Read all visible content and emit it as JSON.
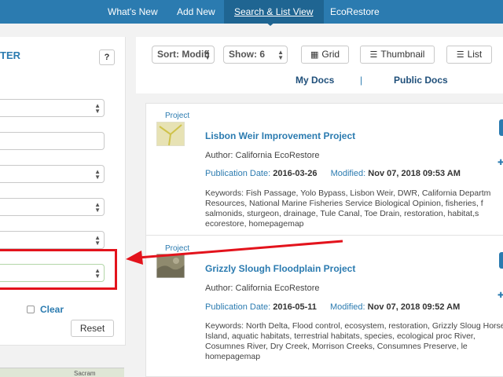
{
  "nav": {
    "items": [
      {
        "label": "What's New"
      },
      {
        "label": "Add New"
      },
      {
        "label": "Search & List View",
        "active": true
      },
      {
        "label": "EcoRestore"
      }
    ]
  },
  "filter": {
    "title": "TER",
    "help_label": "?",
    "clear_label": "Clear",
    "reset_label": "Reset",
    "map_label": "Sacram"
  },
  "toolbar": {
    "sort_label": "Sort: Modifi",
    "show_label": "Show: 6",
    "grid_label": "Grid",
    "thumbnail_label": "Thumbnail",
    "list_label": "List"
  },
  "tabs": {
    "my_docs": "My Docs",
    "separator": "|",
    "public_docs": "Public Docs"
  },
  "results": [
    {
      "type": "Project",
      "title": "Lisbon Weir Improvement Project",
      "author": "Author: California EcoRestore",
      "pub_label": "Publication Date:",
      "pub_date": "2016-03-26",
      "mod_label": "Modified:",
      "mod_date": "Nov 07, 2018 09:53 AM",
      "keywords": "Keywords: Fish Passage, Yolo Bypass, Lisbon Weir, DWR, California Departm Resources, National Marine Fisheries Service Biological Opinion, fisheries, f salmonids, sturgeon, drainage, Tule Canal, Toe Drain, restoration, habitat,s ecorestore, homepagemap"
    },
    {
      "type": "Project",
      "title": "Grizzly Slough Floodplain Project",
      "author": "Author: California EcoRestore",
      "pub_label": "Publication Date:",
      "pub_date": "2016-05-11",
      "mod_label": "Modified:",
      "mod_date": "Nov 07, 2018 09:52 AM",
      "keywords": "Keywords: North Delta, Flood control, ecosystem, restoration, Grizzly Sloug Horse Island, aquatic habitats, terrestrial habitats, species, ecological proc River, Cosumnes River, Dry Creek, Morrison Creeks, Consumnes Preserve, le homepagemap"
    }
  ],
  "colors": {
    "nav_bg": "#2b7bb0",
    "accent": "#2b7bb0",
    "annotation_red": "#e3131c"
  }
}
